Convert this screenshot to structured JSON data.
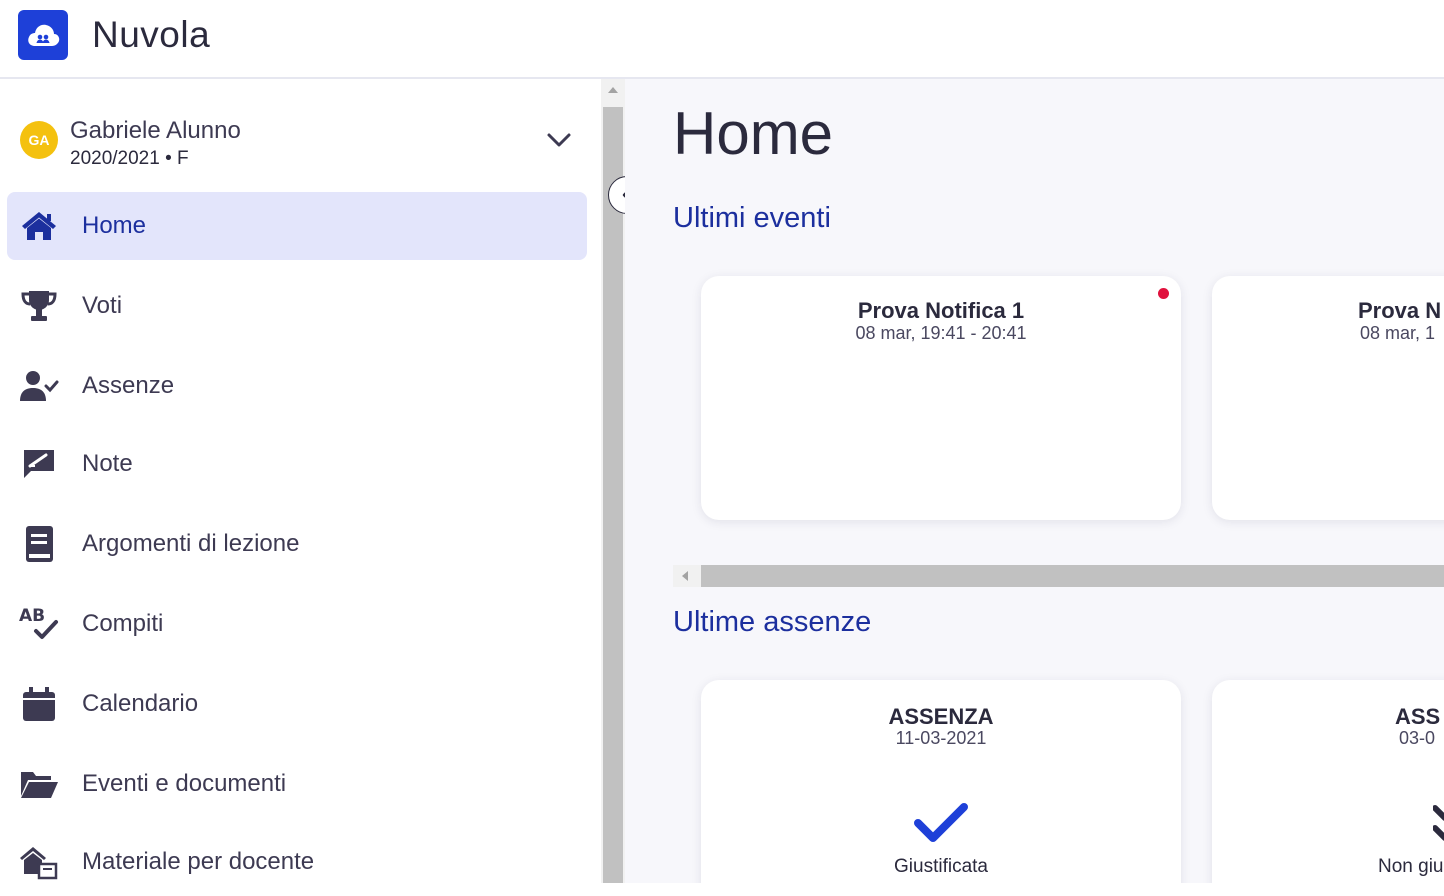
{
  "app": {
    "title": "Nuvola"
  },
  "user": {
    "initials": "GA",
    "name": "Gabriele Alunno",
    "subtitle": "2020/2021 • F"
  },
  "nav": {
    "items": [
      {
        "label": "Home",
        "icon": "home-icon",
        "active": true
      },
      {
        "label": "Voti",
        "icon": "trophy-icon"
      },
      {
        "label": "Assenze",
        "icon": "user-check-icon"
      },
      {
        "label": "Note",
        "icon": "signature-note-icon"
      },
      {
        "label": "Argomenti di lezione",
        "icon": "book-icon"
      },
      {
        "label": "Compiti",
        "icon": "spellcheck-icon"
      },
      {
        "label": "Calendario",
        "icon": "calendar-icon"
      },
      {
        "label": "Eventi e documenti",
        "icon": "folder-open-icon"
      },
      {
        "label": "Materiale per docente",
        "icon": "home-share-icon"
      }
    ]
  },
  "main": {
    "title": "Home",
    "events": {
      "heading": "Ultimi eventi",
      "cards": [
        {
          "title": "Prova Notifica 1",
          "time": "08 mar, 19:41 - 20:41",
          "unread": true
        },
        {
          "title": "Prova N",
          "time": "08 mar, 1"
        }
      ]
    },
    "absences": {
      "heading": "Ultime assenze",
      "cards": [
        {
          "type": "ASSENZA",
          "date": "11-03-2021",
          "status": "Giustificata"
        },
        {
          "type": "ASS",
          "date": "03-0",
          "status": "Non giu"
        }
      ]
    }
  },
  "colors": {
    "brand": "#1e40d8",
    "accent": "#1c2f9e",
    "active_bg": "#e3e5fb",
    "unread_dot": "#e0113d",
    "avatar": "#f4c10f"
  }
}
